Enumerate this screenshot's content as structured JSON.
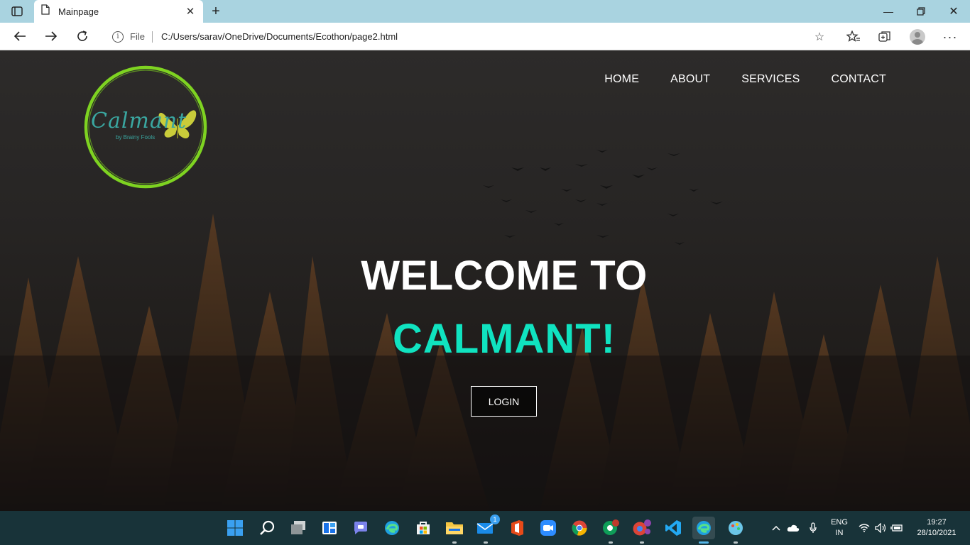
{
  "browser": {
    "tab_title": "Mainpage",
    "address_scheme": "File",
    "address_url": "C:/Users/sarav/OneDrive/Documents/Ecothon/page2.html"
  },
  "site": {
    "logo_wordmark": "Calmant",
    "logo_sub": "by Brainy Fools",
    "nav": [
      "HOME",
      "ABOUT",
      "SERVICES",
      "CONTACT"
    ],
    "hero_line1": "WELCOME TO",
    "hero_line2": "CALMANT!",
    "login_label": "LOGIN"
  },
  "colors": {
    "tabstrip": "#a9d3e0",
    "accent_teal": "#10e3c0",
    "logo_green": "#7ed321",
    "butterfly": "#c9cc3a",
    "taskbar": "#183339"
  },
  "taskbar": {
    "icons": [
      "windows-start-icon",
      "search-icon",
      "task-view-icon",
      "widgets-icon",
      "teams-chat-icon",
      "edge-icon",
      "microsoft-store-icon",
      "file-explorer-icon",
      "mail-icon",
      "office-icon",
      "zoom-icon",
      "chrome-icon",
      "chrome-profile-icon",
      "chrome-profile-2-icon",
      "vscode-icon",
      "edge-active-icon",
      "paint-icon"
    ],
    "mail_badge": "1",
    "lang_primary": "ENG",
    "lang_secondary": "IN",
    "time": "19:27",
    "date": "28/10/2021"
  }
}
